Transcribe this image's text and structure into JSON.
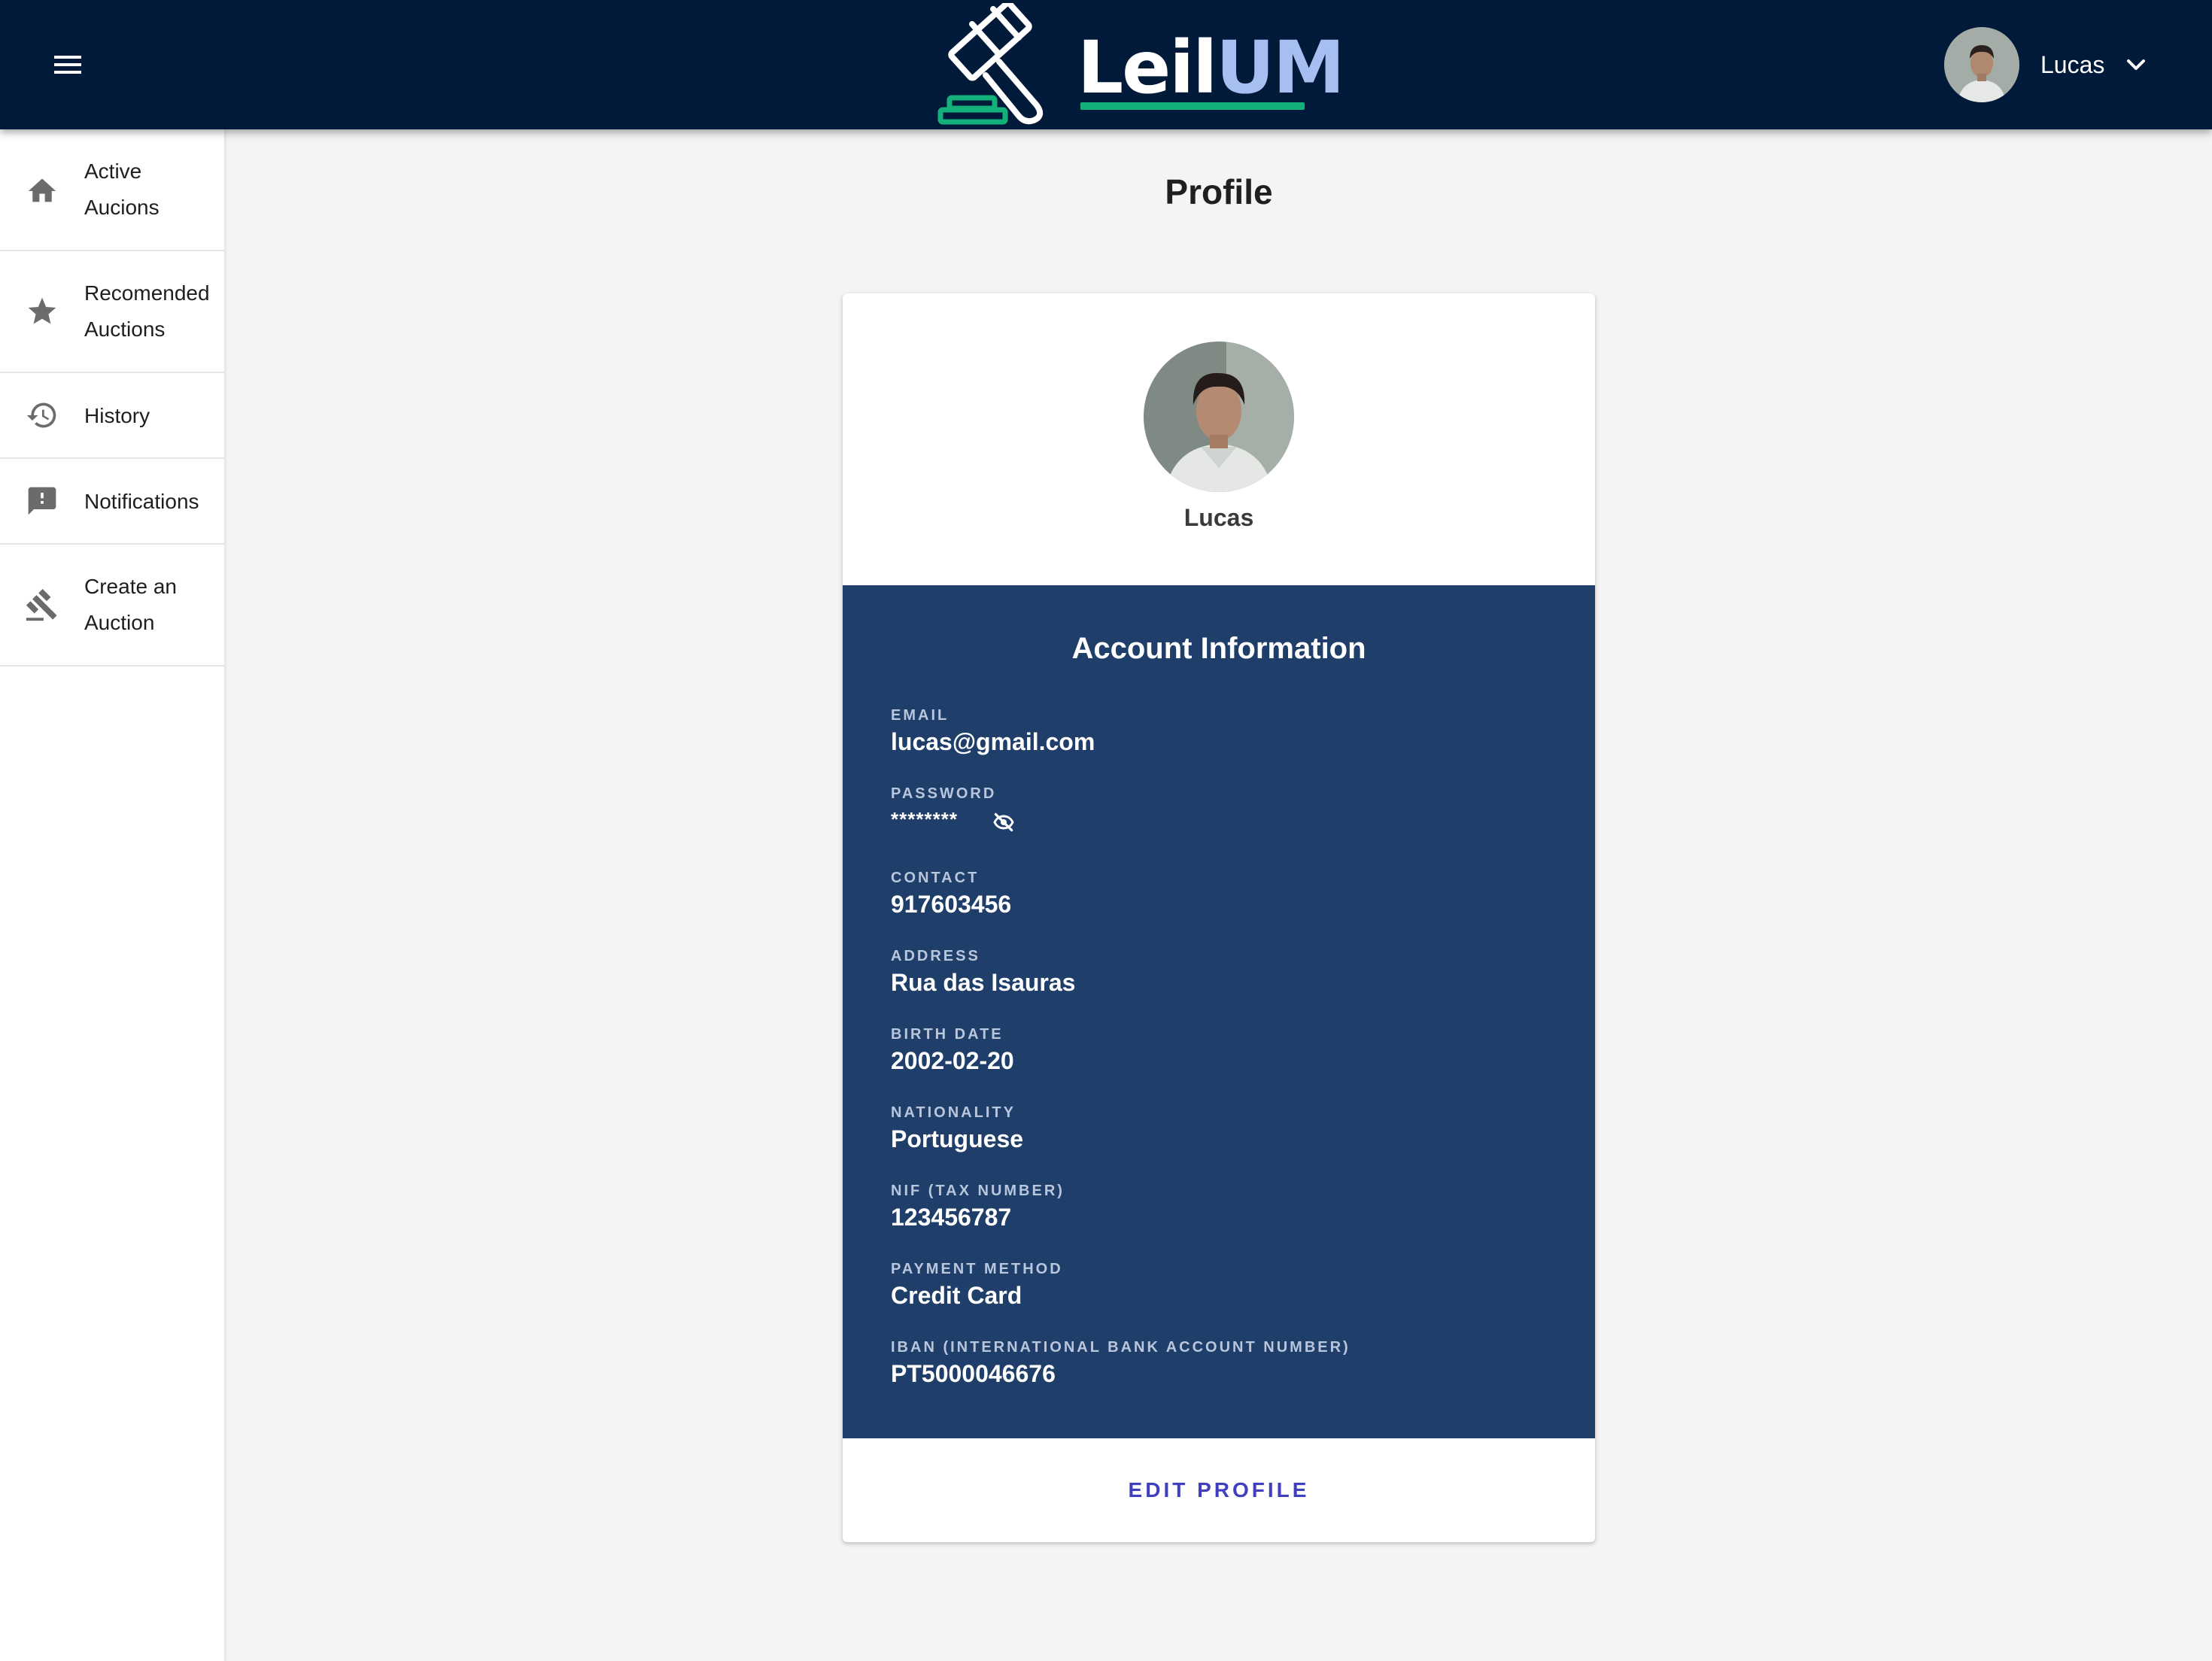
{
  "app": {
    "brand_part1": "Leil",
    "brand_part2": "UM"
  },
  "header": {
    "user_name": "Lucas"
  },
  "sidebar": {
    "items": [
      {
        "line1": "Active",
        "line2": "Aucions",
        "icon": "home-icon"
      },
      {
        "line1": "Recomended",
        "line2": "Auctions",
        "icon": "star-icon"
      },
      {
        "line1": "History",
        "line2": "",
        "icon": "history-icon"
      },
      {
        "line1": "Notifications",
        "line2": "",
        "icon": "feedback-icon"
      },
      {
        "line1": "Create an",
        "line2": "Auction",
        "icon": "gavel-icon"
      }
    ]
  },
  "main": {
    "title": "Profile",
    "profile_name": "Lucas",
    "section_title": "Account Information",
    "fields": {
      "email": {
        "label": "EMAIL",
        "value": "lucas@gmail.com"
      },
      "password": {
        "label": "PASSWORD",
        "value": "********"
      },
      "contact": {
        "label": "CONTACT",
        "value": "917603456"
      },
      "address": {
        "label": "ADDRESS",
        "value": "Rua das Isauras"
      },
      "birth_date": {
        "label": "BIRTH DATE",
        "value": "2002-02-20"
      },
      "nationality": {
        "label": "NATIONALITY",
        "value": "Portuguese"
      },
      "nif": {
        "label": "NIF (TAX NUMBER)",
        "value": "123456787"
      },
      "payment": {
        "label": "PAYMENT METHOD",
        "value": "Credit Card"
      },
      "iban": {
        "label": "IBAN (INTERNATIONAL BANK ACCOUNT NUMBER)",
        "value": "PT5000046676"
      }
    },
    "edit_label": "EDIT PROFILE"
  },
  "colors": {
    "topbar": "#021a3a",
    "info_panel": "#1f3f6a",
    "accent_green": "#13b07a",
    "brand_blue": "#a7bff0",
    "link": "#3f3fbf"
  }
}
